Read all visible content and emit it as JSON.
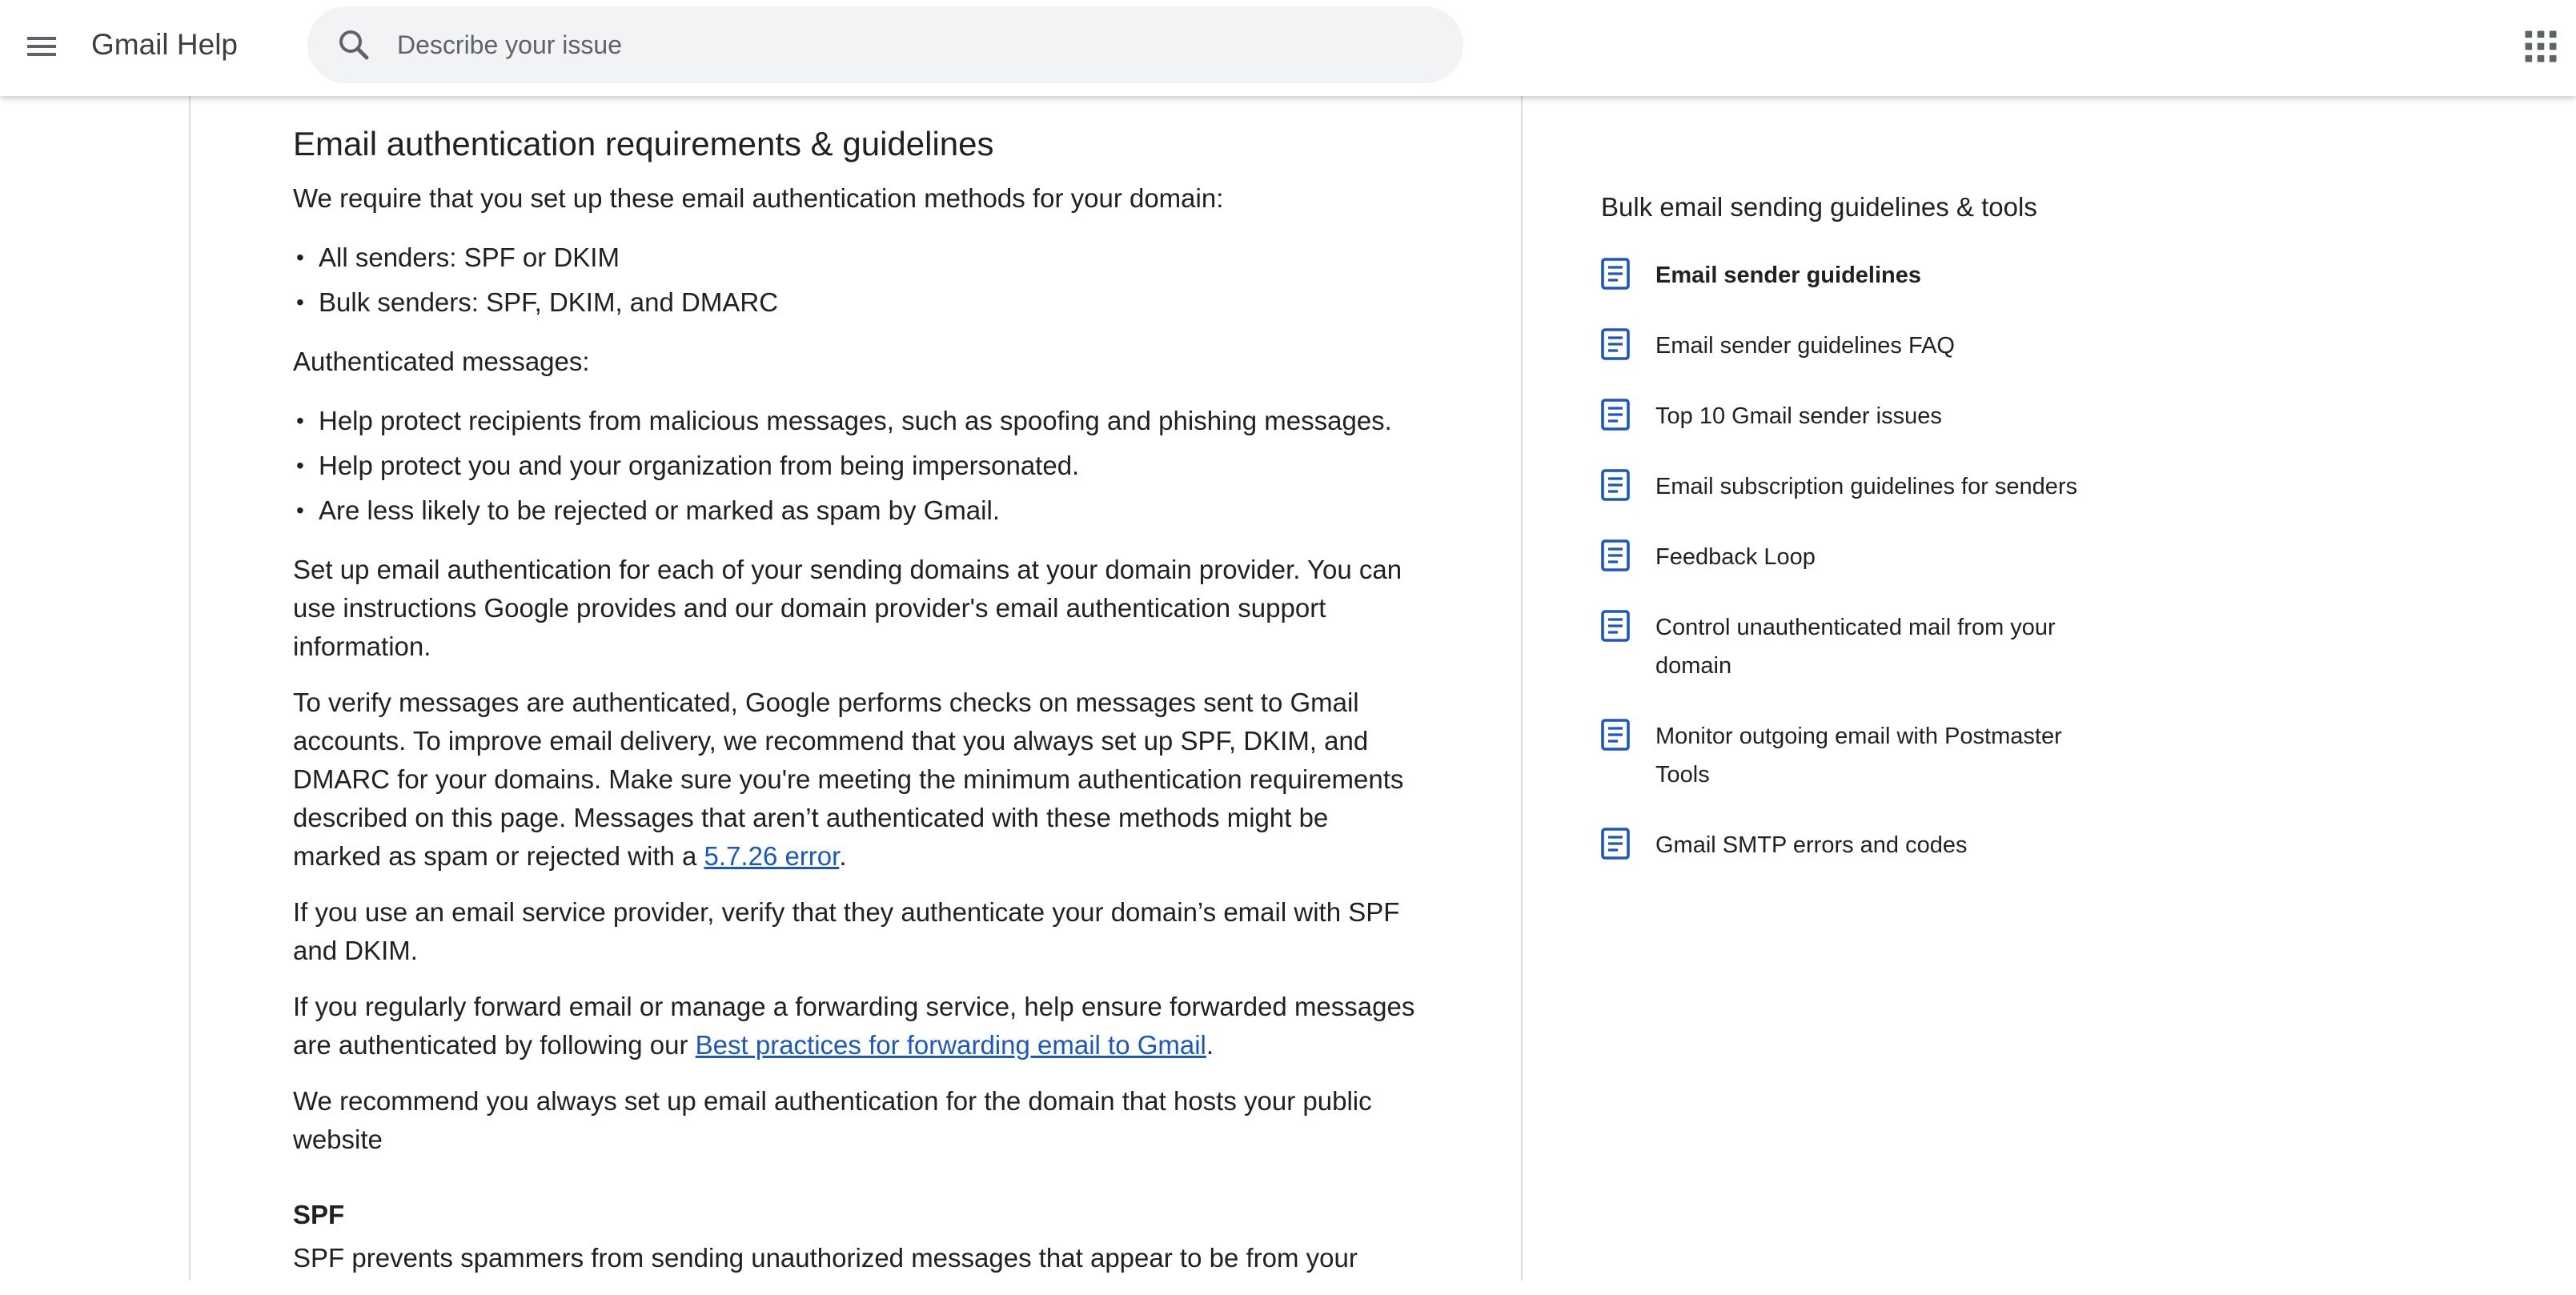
{
  "header": {
    "title": "Gmail Help",
    "search_placeholder": "Describe your issue",
    "icons": [
      "menu-icon",
      "search-icon",
      "apps-grid-icon"
    ]
  },
  "article": {
    "heading": "Email authentication requirements & guidelines",
    "intro": "We require that you set up these email authentication methods for your domain:",
    "senders": [
      "All senders: SPF or DKIM",
      "Bulk senders: SPF, DKIM, and DMARC"
    ],
    "authenticated_label": "Authenticated messages:",
    "benefits": [
      "Help protect recipients from malicious messages, such as spoofing and phishing messages.",
      "Help protect you and your organization from being impersonated.",
      "Are less likely to be rejected or marked as spam by Gmail."
    ],
    "p_setup": "Set up email authentication for each of your sending domains at your domain provider. You can use instructions Google provides and our domain provider's email authentication support information.",
    "p_verify_before": "To verify messages are authenticated, Google performs checks on messages sent to Gmail accounts. To improve email delivery, we recommend that you always set up SPF, DKIM, and DMARC for your domains. Make sure you're meeting the minimum authentication requirements described on this page. Messages that aren’t authenticated with these methods might be marked as spam or rejected with a ",
    "p_verify_link": "5.7.26 error",
    "p_verify_after": ".",
    "p_provider": "If you use an email service provider, verify that they authenticate your domain’s email with SPF and DKIM.",
    "p_forward_before": "If you regularly forward email or manage a forwarding service, help ensure forwarded messages are authenticated by following our ",
    "p_forward_link": "Best practices for forwarding email to Gmail",
    "p_forward_after": ".",
    "p_recommend": "We recommend you always set up email authentication for the domain that hosts your public website",
    "spf_heading": "SPF",
    "spf_text": "SPF prevents spammers from sending unauthorized messages that appear to be from your"
  },
  "sidebar": {
    "title": "Bulk email sending guidelines & tools",
    "items": [
      {
        "label": "Email sender guidelines",
        "active": true
      },
      {
        "label": "Email sender guidelines FAQ"
      },
      {
        "label": "Top 10 Gmail sender issues"
      },
      {
        "label": "Email subscription guidelines for senders"
      },
      {
        "label": "Feedback Loop"
      },
      {
        "label": "Control unauthenticated mail from your domain"
      },
      {
        "label": "Monitor outgoing email with Postmaster Tools"
      },
      {
        "label": "Gmail SMTP errors and codes"
      }
    ]
  },
  "colors": {
    "link": "#1a57c2",
    "doc_icon": "#1a57c2",
    "search_bg": "#f1f3f4",
    "divider": "#dadce0"
  }
}
